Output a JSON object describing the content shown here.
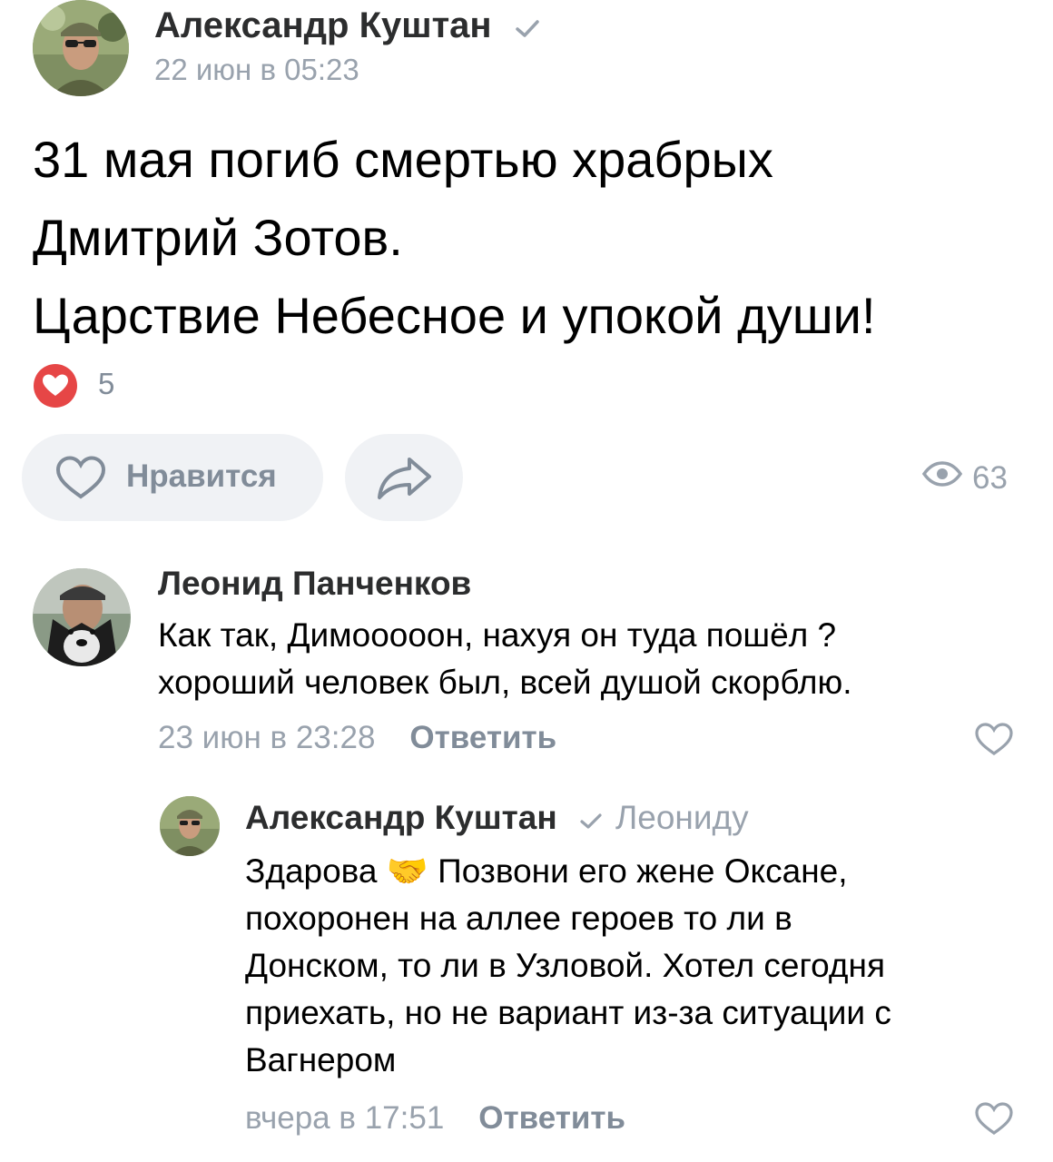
{
  "post": {
    "author": "Александр Куштан",
    "date": "22 июн в 05:23",
    "text_lines": [
      "31 мая погиб смертью храбрых",
      "Дмитрий Зотов.",
      "Царствие Небесное и упокой души!"
    ],
    "reactions_count": "5",
    "like_label": "Нравится",
    "views": "63"
  },
  "comments": [
    {
      "author": "Леонид Панченков",
      "text_lines": [
        "Как так, Димооооон, нахуя он туда пошёл ?",
        "хороший человек был, всей душой скорблю."
      ],
      "date": "23 июн в 23:28",
      "reply_label": "Ответить"
    },
    {
      "author": "Александр Куштан",
      "reply_to": "Леониду",
      "text_lines": [
        "Здарова 🤝 Позвони его жене Оксане,",
        "похоронен на аллее героев то ли в",
        "Донском, то ли в Узловой. Хотел сегодня",
        "приехать, но не вариант из-за ситуации с",
        "Вагнером"
      ],
      "date": "вчера в 17:51",
      "reply_label": "Ответить"
    }
  ],
  "icons": {
    "verified": "checkmark-icon",
    "reaction": "heart-icon",
    "like": "heart-outline-icon",
    "share": "share-arrow-icon",
    "views": "eye-icon"
  },
  "colors": {
    "reaction_red": "#e64646",
    "secondary_text": "#99a2ad",
    "button_bg": "#f0f2f5"
  }
}
